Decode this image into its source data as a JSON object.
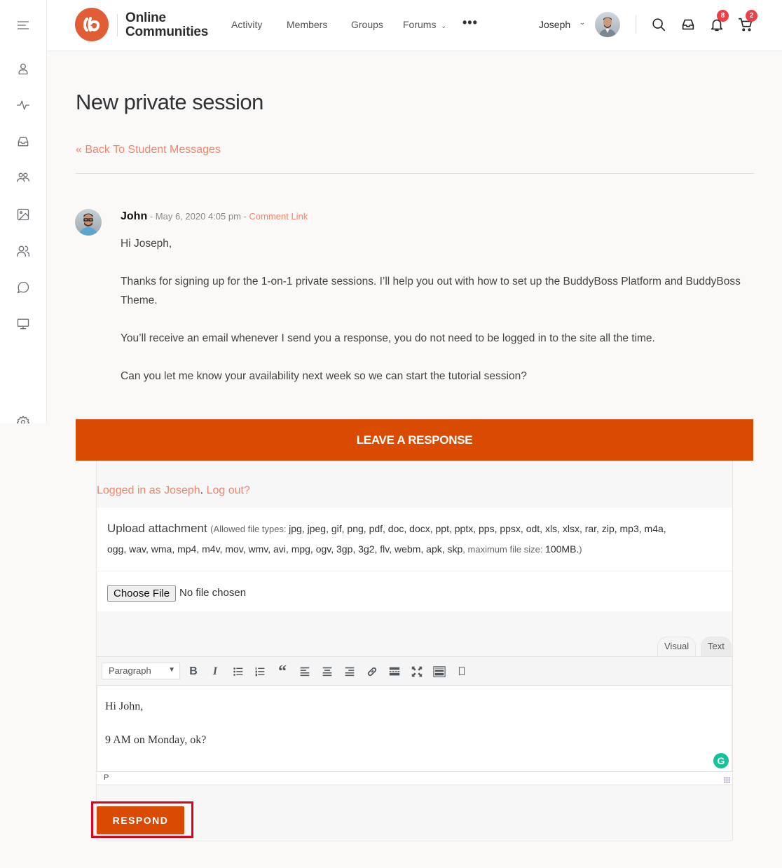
{
  "header": {
    "brand_line1": "Online",
    "brand_line2": "Communities",
    "nav": [
      {
        "label": "Activity"
      },
      {
        "label": "Members"
      },
      {
        "label": "Groups"
      },
      {
        "label": "Forums",
        "has_dropdown": true
      }
    ],
    "more_label": "•••",
    "user_name": "Joseph",
    "notification_count": "8",
    "cart_count": "2"
  },
  "sidebar": {
    "items": [
      {
        "icon": "menu-icon"
      },
      {
        "icon": "profile-icon"
      },
      {
        "icon": "activity-icon"
      },
      {
        "icon": "inbox-icon"
      },
      {
        "icon": "groups-icon"
      },
      {
        "icon": "photos-icon"
      },
      {
        "icon": "members-icon"
      },
      {
        "icon": "forums-icon"
      },
      {
        "icon": "courses-icon"
      },
      {
        "icon": "settings-icon"
      }
    ]
  },
  "page": {
    "title": "New private session",
    "back_link": "« Back To Student Messages"
  },
  "comment": {
    "author": "John",
    "separator1": " - ",
    "date": "May 6, 2020 4:05 pm",
    "separator2": " - ",
    "link_label": "Comment Link",
    "paragraphs": [
      "Hi Joseph,",
      "Thanks for signing up for the 1-on-1 private sessions. I’ll help you out with how to set up the BuddyBoss Platform and BuddyBoss Theme.",
      "You’ll receive an email whenever I send you a response, you do not need to be logged in to the site all the time.",
      "Can you let me know your availability next week so we can start the tutorial session?"
    ]
  },
  "response": {
    "heading": "LEAVE A RESPONSE",
    "logged_in_text": "Logged in as Joseph",
    "logout_text": "Log out?",
    "upload_title": "Upload attachment",
    "allowed_prefix": "(Allowed file types: ",
    "allowed_types_line1": "jpg, jpeg, gif, png, pdf, doc, docx, ppt, pptx, pps, ppsx, odt, xls, xlsx, rar, zip, mp3, m4a,",
    "allowed_types_line2": "ogg, wav, wma, mp4, m4v, mov, wmv, avi, mpg, ogv, 3gp, 3g2, flv, webm, apk, skp",
    "max_size_label": ", maximum file size: ",
    "max_size_value": "100MB.",
    "close_paren": ")",
    "choose_file_label": "Choose File",
    "file_status": "No file chosen",
    "tab_visual": "Visual",
    "tab_text": "Text",
    "format_select": "Paragraph",
    "toolbar_buttons": [
      "bold",
      "italic",
      "bullet-list",
      "numbered-list",
      "blockquote",
      "align-left",
      "align-center",
      "align-right",
      "link",
      "read-more",
      "fullscreen",
      "toolbar-toggle",
      "placeholder"
    ],
    "editor_lines": [
      "Hi John,",
      "9 AM on Monday, ok?"
    ],
    "path_label": "P",
    "submit_label": "RESPOND"
  },
  "colors": {
    "accent": "#d94a02",
    "link": "#f2856a",
    "badge": "#ef3e46",
    "logo": "#e05d36",
    "highlight": "#e3001b"
  }
}
